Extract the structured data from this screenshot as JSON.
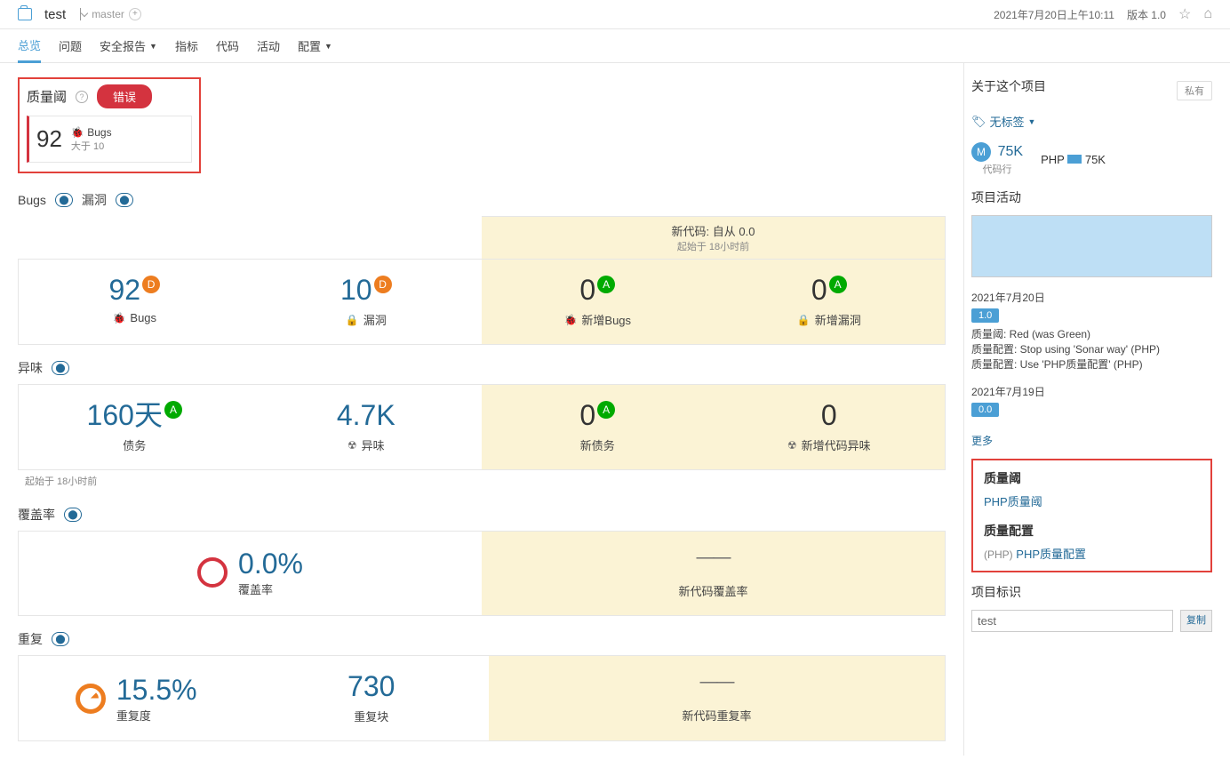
{
  "header": {
    "project_name": "test",
    "branch": "master",
    "timestamp": "2021年7月20日上午10:11",
    "version": "版本 1.0"
  },
  "tabs": {
    "overview": "总览",
    "issues": "问题",
    "security": "安全报告",
    "metrics": "指标",
    "code": "代码",
    "activity": "活动",
    "config": "配置"
  },
  "quality_gate": {
    "label": "质量阈",
    "status": "错误",
    "value": "92",
    "metric": "Bugs",
    "condition": "大于 10"
  },
  "sections": {
    "bugs_label": "Bugs",
    "vuln_label": "漏洞",
    "new_code_header": "新代码: 自从 0.0",
    "new_code_sub": "起始于 18小时前",
    "smells_label": "异味",
    "coverage_label": "覆盖率",
    "dup_label": "重复"
  },
  "metrics": {
    "bugs": {
      "value": "92",
      "rating": "D",
      "label": "Bugs"
    },
    "vuln": {
      "value": "10",
      "rating": "D",
      "label": "漏洞"
    },
    "new_bugs": {
      "value": "0",
      "rating": "A",
      "label": "新增Bugs"
    },
    "new_vuln": {
      "value": "0",
      "rating": "A",
      "label": "新增漏洞"
    },
    "debt": {
      "value": "160天",
      "rating": "A",
      "label": "债务"
    },
    "smells": {
      "value": "4.7K",
      "label": "异味"
    },
    "new_debt": {
      "value": "0",
      "rating": "A",
      "label": "新债务"
    },
    "new_smells": {
      "value": "0",
      "label": "新增代码异味"
    },
    "started_note": "起始于 18小时前",
    "coverage": {
      "value": "0.0%",
      "label": "覆盖率"
    },
    "new_coverage": {
      "label": "新代码覆盖率"
    },
    "dup": {
      "value": "15.5%",
      "label": "重复度"
    },
    "dup_blocks": {
      "value": "730",
      "label": "重复块"
    },
    "new_dup": {
      "label": "新代码重复率"
    }
  },
  "sidebar": {
    "about": "关于这个项目",
    "private": "私有",
    "no_tags": "无标签",
    "loc_value": "75K",
    "loc_label": "代码行",
    "lang": "PHP",
    "lang_value": "75K",
    "activity_title": "项目活动",
    "entry1": {
      "date": "2021年7月20日",
      "version": "1.0",
      "line1": "质量阈: Red (was Green)",
      "line2": "质量配置: Stop using 'Sonar way' (PHP)",
      "line3": "质量配置: Use 'PHP质量配置' (PHP)"
    },
    "entry2": {
      "date": "2021年7月19日",
      "version": "0.0"
    },
    "more": "更多",
    "qg_title": "质量阈",
    "qg_link": "PHP质量阈",
    "qp_title": "质量配置",
    "qp_lang": "(PHP)",
    "qp_link": "PHP质量配置",
    "proj_id_title": "项目标识",
    "proj_id_value": "test",
    "copy": "复制"
  }
}
